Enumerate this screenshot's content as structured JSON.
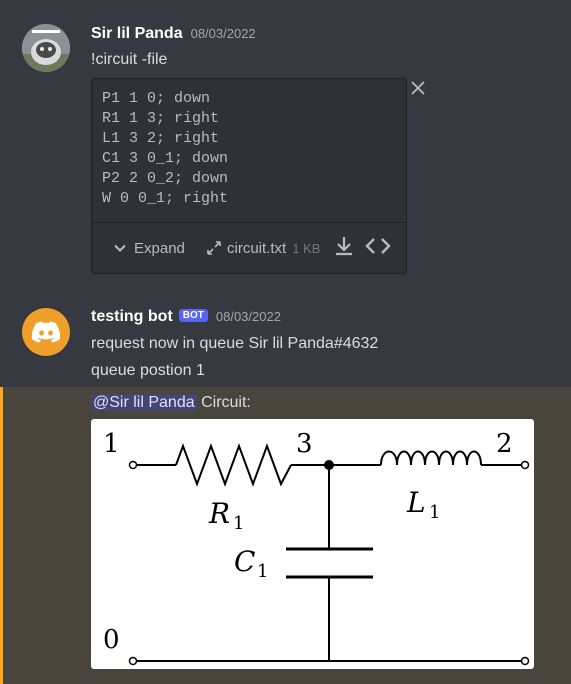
{
  "message1": {
    "author": "Sir lil Panda",
    "timestamp": "08/03/2022",
    "text": "!circuit -file",
    "attachment": {
      "lines": [
        "P1 1 0; down",
        "R1 1 3; right",
        "L1 3 2; right",
        "C1 3 0_1; down",
        "P2 2 0_2; down",
        "W 0 0_1; right"
      ],
      "expand_label": "Expand",
      "filename": "circuit.txt",
      "filesize": "1 KB"
    }
  },
  "message2": {
    "author": "testing bot",
    "badge": "BOT",
    "timestamp": "08/03/2022",
    "line1": "request now in queue Sir lil Panda#4632",
    "line2": "queue postion 1",
    "mention": "@Sir lil Panda",
    "mention_text": "Circuit:"
  },
  "circuit": {
    "node_labels": [
      "1",
      "3",
      "2",
      "0"
    ],
    "r_label": "R",
    "r_sub": "1",
    "l_label": "L",
    "l_sub": "1",
    "c_label": "C",
    "c_sub": "1"
  },
  "colors": {
    "background": "#36393f",
    "highlight": "#49443c",
    "highlight_bar": "#faa81a",
    "bot_badge": "#5865f2",
    "bot_avatar": "#f0a02a"
  }
}
